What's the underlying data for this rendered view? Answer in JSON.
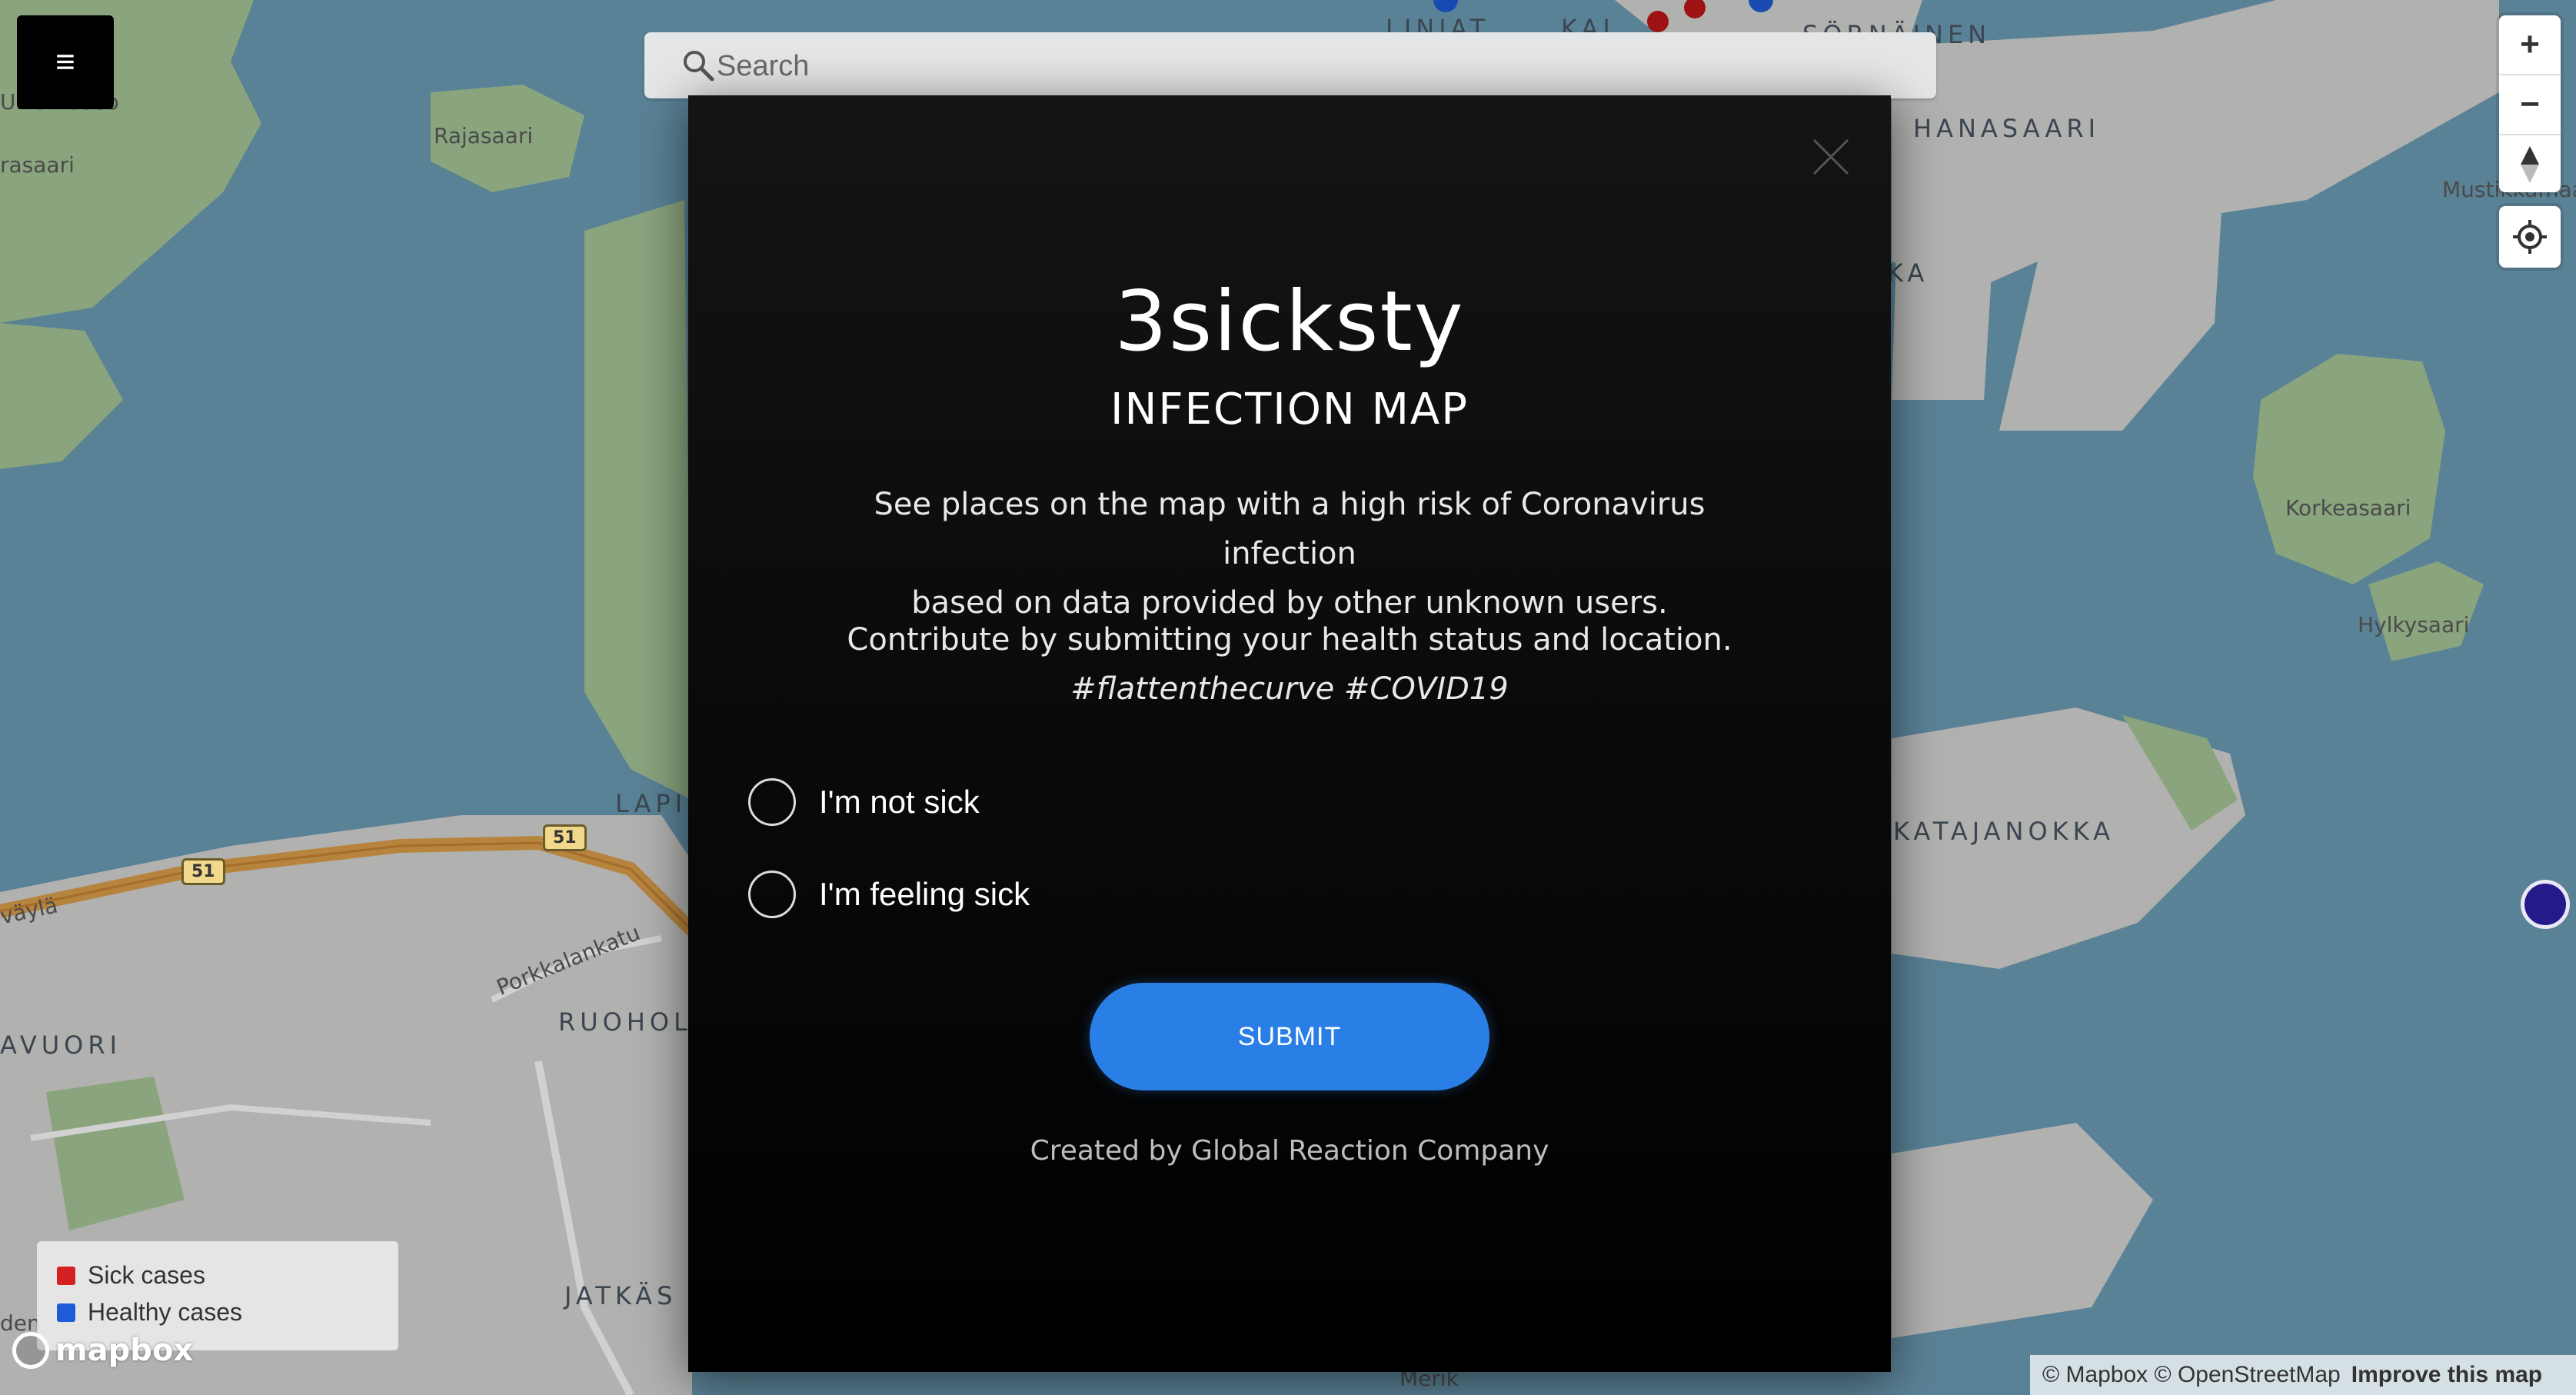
{
  "app": {
    "menu_icon": "hamburger-icon",
    "search": {
      "placeholder": "Search",
      "icon": "search-icon"
    },
    "map_controls": {
      "zoom_in": "+",
      "zoom_out": "−",
      "compass_icon": "compass-icon",
      "geolocate_icon": "geolocate-icon"
    }
  },
  "map": {
    "labels": {
      "rajasaari": "Rajasaari",
      "ulkomuseo": "Ulkomuseo",
      "rasaari": "rasaari",
      "hanasaari": "HANASAARI",
      "mustikkamaa": "Mustikkamaa",
      "korkeasaari": "Korkeasaari",
      "hylkysaari": "Hylkysaari",
      "katajanokka": "KATAJANOKKA",
      "lapi": "LAPI",
      "ruohol": "RUOHOL",
      "jatkas": "JATKÄS",
      "avuori": "AVUORI",
      "porkkalankatu": "Porkkalankatu",
      "vayla": "väylä",
      "linjat": "LINJAT",
      "kal": "KAL",
      "sornainen": "SÖRNÄINEN",
      "ka": "KA",
      "merika": "Merik",
      "den": "den",
      "road_51": "51"
    },
    "colors": {
      "water": "#6e9fb8",
      "land": "#d8d8d6",
      "park": "#a9c89a",
      "road_major": "#e0a14c"
    }
  },
  "legend": {
    "items": [
      {
        "label": "Sick cases",
        "color": "#d42020"
      },
      {
        "label": "Healthy cases",
        "color": "#1f5bd8"
      }
    ]
  },
  "attribution": {
    "mapbox_logo": "mapbox",
    "text": "© Mapbox © OpenStreetMap",
    "improve": "Improve this map"
  },
  "modal": {
    "close_icon": "close-icon",
    "title": "3sicksty",
    "subtitle": "INFECTION MAP",
    "description_line1": "See places on the map with a high risk of Coronavirus infection",
    "description_line2": "based on data provided by other unknown users.",
    "contribute": "Contribute by submitting your health status and location.",
    "hashtags": "#flattenthecurve #COVID19",
    "options": [
      {
        "label": "I'm not sick"
      },
      {
        "label": "I'm feeling sick"
      }
    ],
    "submit_label": "SUBMIT",
    "credit": "Created by Global Reaction Company"
  }
}
